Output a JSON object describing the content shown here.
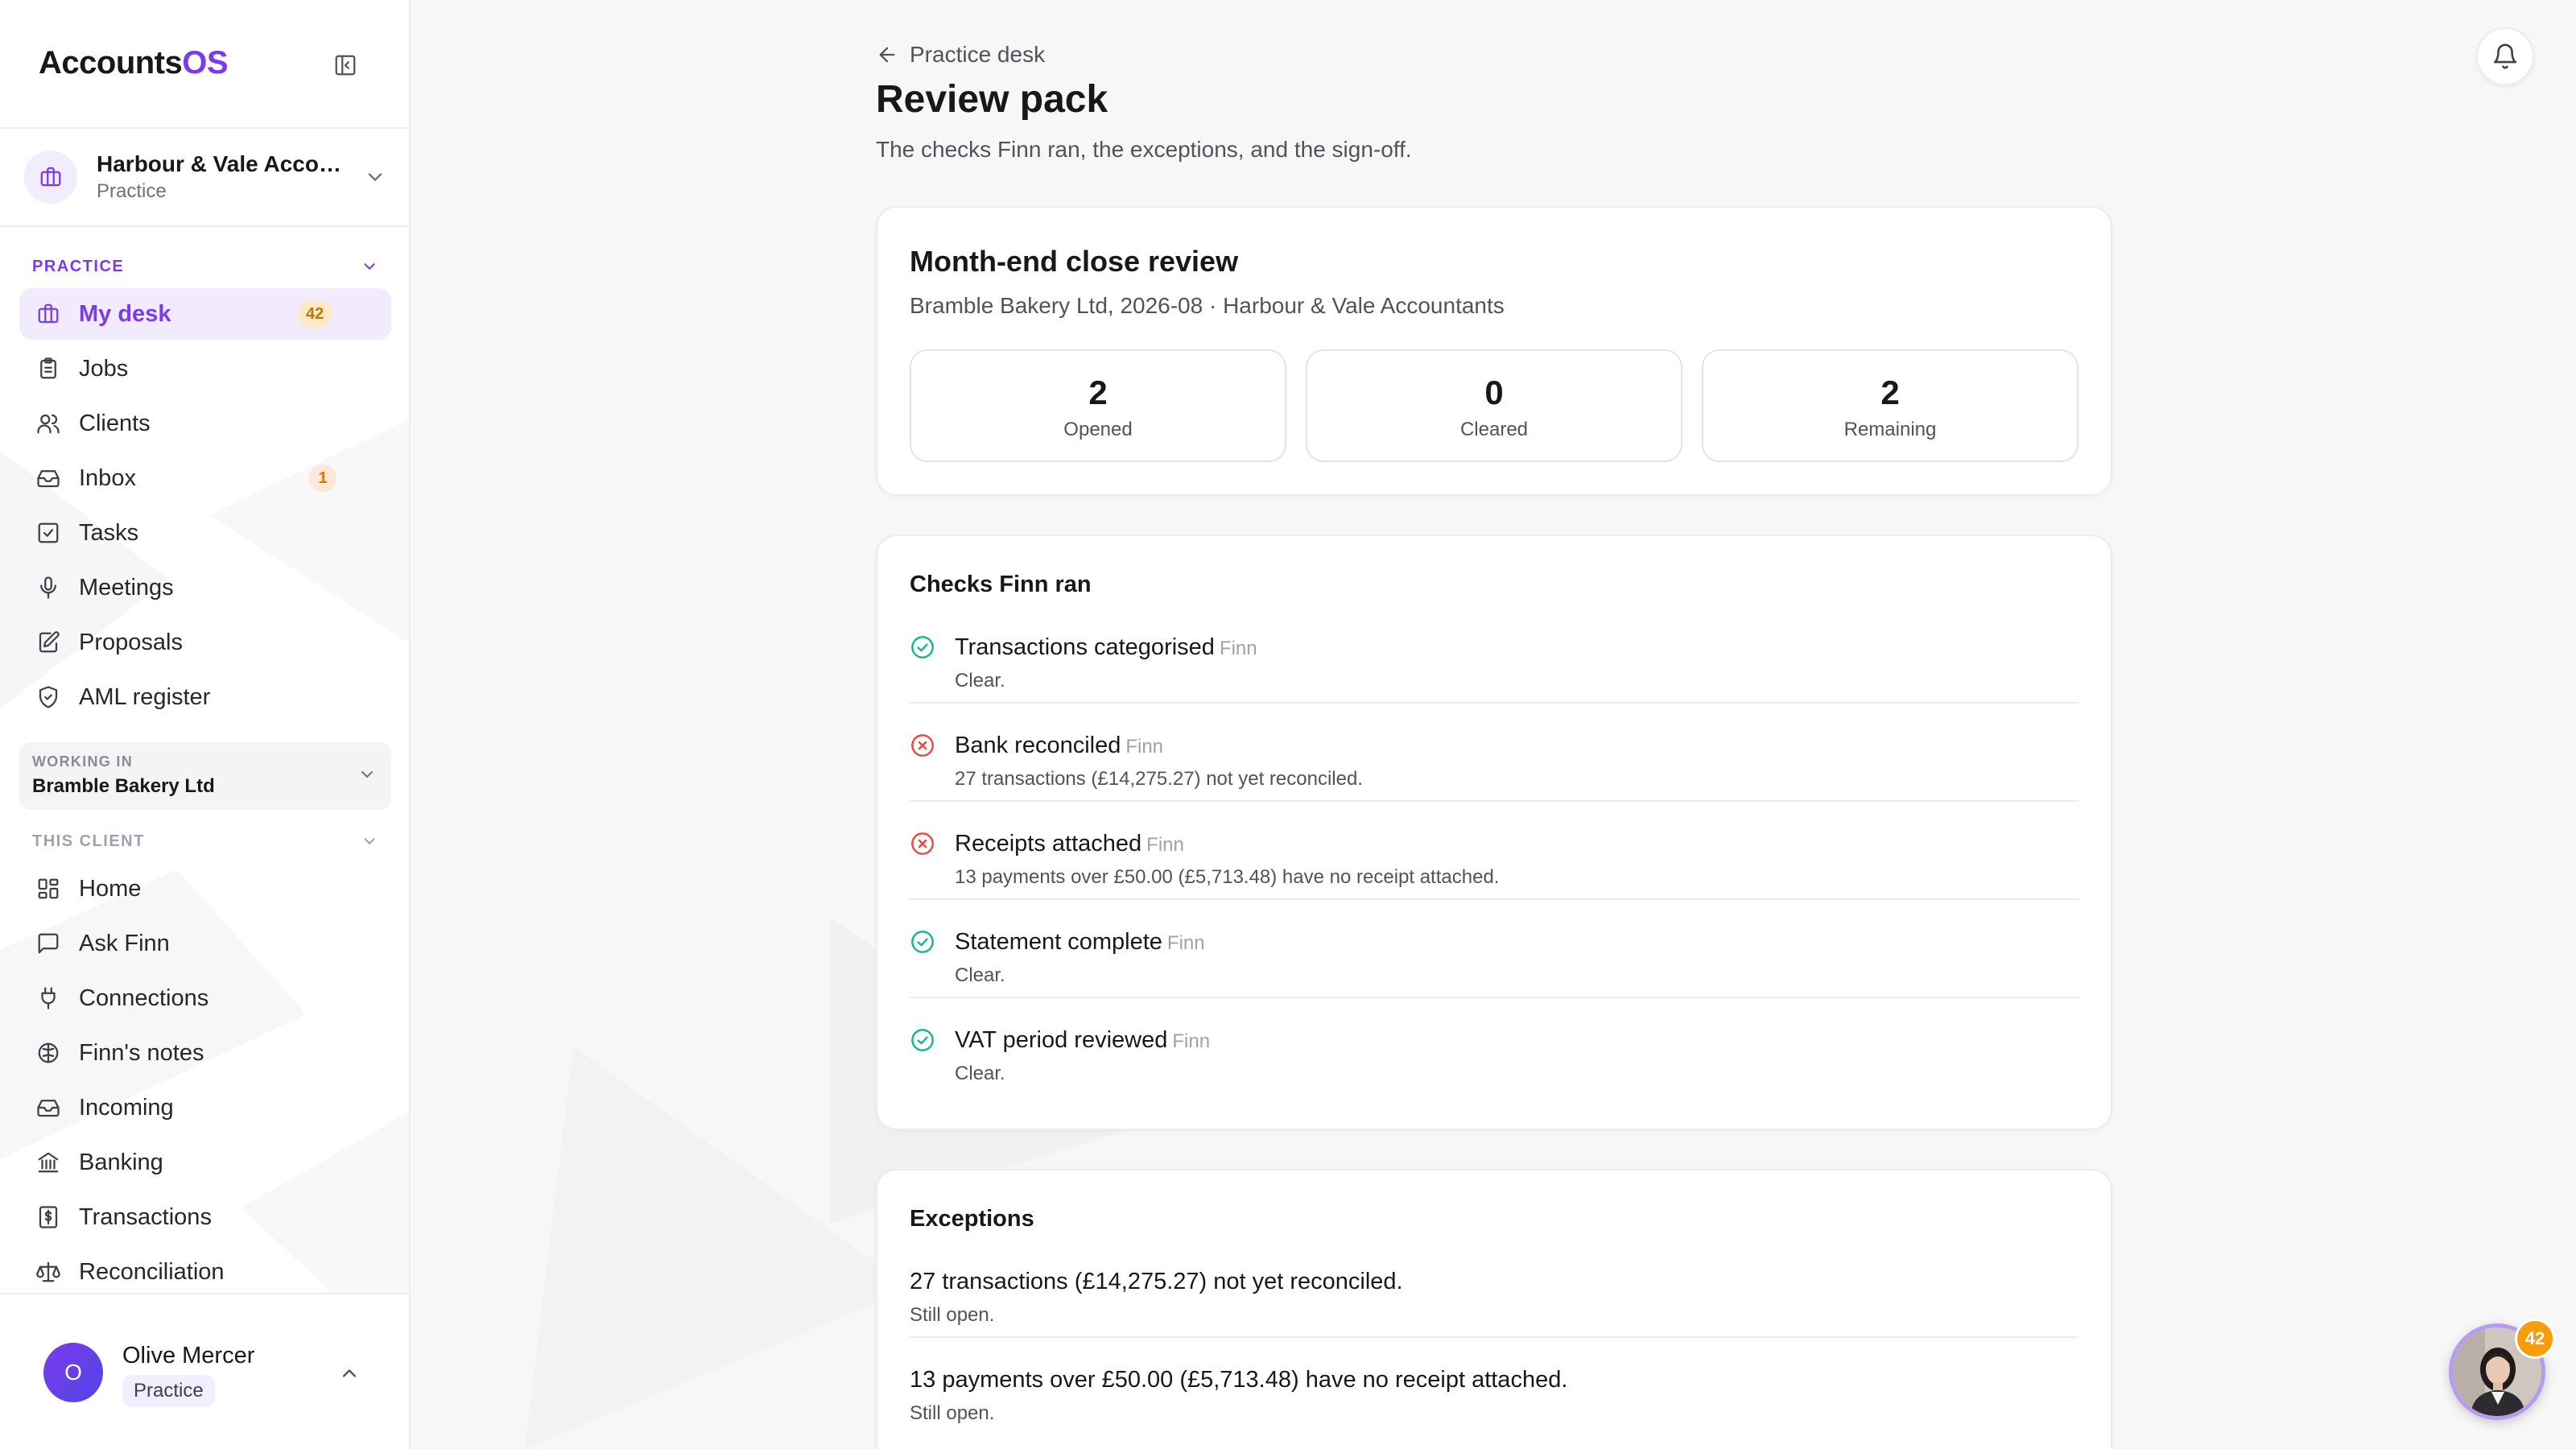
{
  "brand": {
    "name_main": "Accounts",
    "name_accent": "OS"
  },
  "practice_switcher": {
    "name": "Harbour & Vale Accou…",
    "role": "Practice"
  },
  "practice_section": {
    "label": "PRACTICE",
    "items": [
      {
        "label": "My desk",
        "icon": "briefcase-icon",
        "badge": "42",
        "active": true
      },
      {
        "label": "Jobs",
        "icon": "clipboard-icon"
      },
      {
        "label": "Clients",
        "icon": "users-icon"
      },
      {
        "label": "Inbox",
        "icon": "inbox-icon",
        "badge": "1"
      },
      {
        "label": "Tasks",
        "icon": "check-square-icon"
      },
      {
        "label": "Meetings",
        "icon": "microphone-icon"
      },
      {
        "label": "Proposals",
        "icon": "edit-document-icon"
      },
      {
        "label": "AML register",
        "icon": "shield-check-icon"
      }
    ]
  },
  "working_in": {
    "label": "WORKING IN",
    "value": "Bramble Bakery Ltd"
  },
  "client_section": {
    "label": "THIS CLIENT",
    "items": [
      {
        "label": "Home",
        "icon": "grid-icon"
      },
      {
        "label": "Ask Finn",
        "icon": "chat-icon"
      },
      {
        "label": "Connections",
        "icon": "plug-icon"
      },
      {
        "label": "Finn's notes",
        "icon": "brain-icon"
      },
      {
        "label": "Incoming",
        "icon": "inbox-icon"
      },
      {
        "label": "Banking",
        "icon": "bank-icon"
      },
      {
        "label": "Transactions",
        "icon": "receipt-dollar-icon"
      },
      {
        "label": "Reconciliation",
        "icon": "scale-icon"
      }
    ]
  },
  "user": {
    "initial": "O",
    "name": "Olive Mercer",
    "role": "Practice"
  },
  "header": {
    "back_label": "Practice desk",
    "title": "Review pack",
    "subtitle": "The checks Finn ran, the exceptions, and the sign-off."
  },
  "review": {
    "title": "Month-end close review",
    "subtitle": "Bramble Bakery Ltd, 2026-08 · Harbour & Vale Accountants",
    "stats": [
      {
        "value": "2",
        "label": "Opened"
      },
      {
        "value": "0",
        "label": "Cleared"
      },
      {
        "value": "2",
        "label": "Remaining"
      }
    ]
  },
  "checks": {
    "title": "Checks Finn ran",
    "items": [
      {
        "name": "Transactions categorised",
        "by": "Finn",
        "detail": "Clear.",
        "status": "pass"
      },
      {
        "name": "Bank reconciled",
        "by": "Finn",
        "detail": "27 transactions (£14,275.27) not yet reconciled.",
        "status": "fail"
      },
      {
        "name": "Receipts attached",
        "by": "Finn",
        "detail": "13 payments over £50.00 (£5,713.48) have no receipt attached.",
        "status": "fail"
      },
      {
        "name": "Statement complete",
        "by": "Finn",
        "detail": "Clear.",
        "status": "pass"
      },
      {
        "name": "VAT period reviewed",
        "by": "Finn",
        "detail": "Clear.",
        "status": "pass"
      }
    ]
  },
  "exceptions": {
    "title": "Exceptions",
    "items": [
      {
        "text": "27 transactions (£14,275.27) not yet reconciled.",
        "status": "Still open."
      },
      {
        "text": "13 payments over £50.00 (£5,713.48) have no receipt attached.",
        "status": "Still open."
      }
    ]
  },
  "assistant": {
    "badge": "42"
  },
  "colors": {
    "accent": "#7c3aed",
    "pass": "#10b981",
    "fail": "#ef4444",
    "badge": "#f59e0b"
  }
}
